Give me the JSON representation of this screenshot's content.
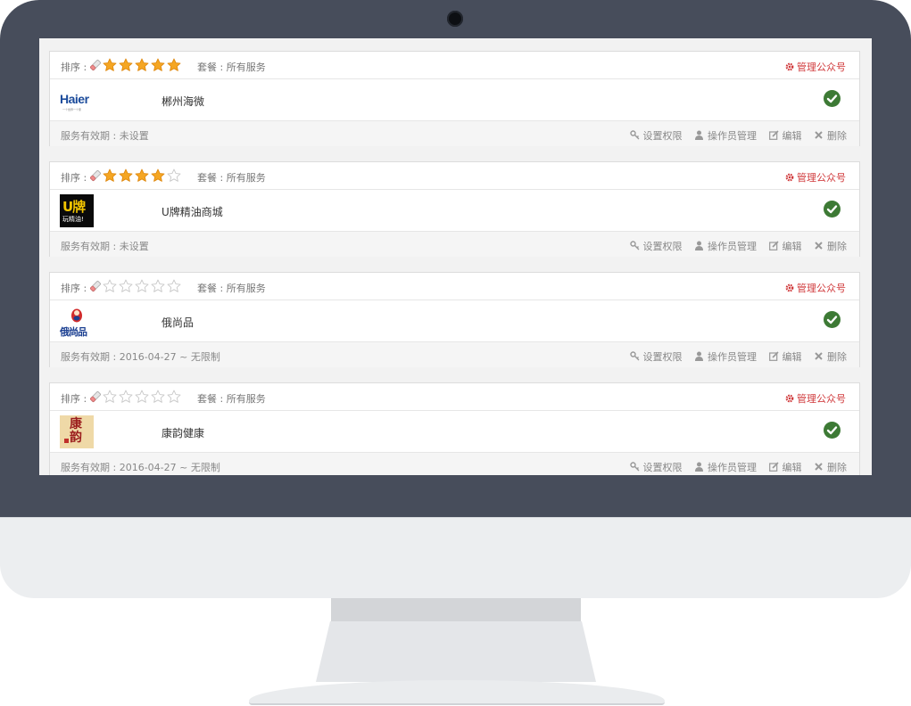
{
  "colors": {
    "bezel": "#474d5b",
    "accent_red": "#d0393b",
    "check_green": "#3d7a35",
    "star_gold": "#f5a623"
  },
  "labels": {
    "rank": "排序 :",
    "manage": "管理公众号",
    "set_permission": "设置权限",
    "operator_manage": "操作员管理",
    "edit": "编辑",
    "delete": "删除"
  },
  "accounts": [
    {
      "name": "郴州海微",
      "stars": 5,
      "package": "套餐 : 所有服务",
      "validity": "服务有效期 : 未设置",
      "logo_text": "Haier",
      "logo_subtext": "一个世界一个家",
      "status": "active"
    },
    {
      "name": "U牌精油商城",
      "stars": 4,
      "package": "套餐 : 所有服务",
      "validity": "服务有效期 : 未设置",
      "logo_text": "U牌",
      "logo_subtext": "玩精油!",
      "status": "active"
    },
    {
      "name": "俄尚品",
      "stars": 0,
      "package": "套餐 : 所有服务",
      "validity": "服务有效期 : 2016-04-27 ~ 无限制",
      "logo_text": "俄尚品",
      "logo_subtext": "",
      "status": "active"
    },
    {
      "name": "康韵健康",
      "stars": 0,
      "package": "套餐 : 所有服务",
      "validity": "服务有效期 : 2016-04-27 ~ 无限制",
      "logo_text": "康韵",
      "logo_subtext": "",
      "status": "active"
    }
  ]
}
